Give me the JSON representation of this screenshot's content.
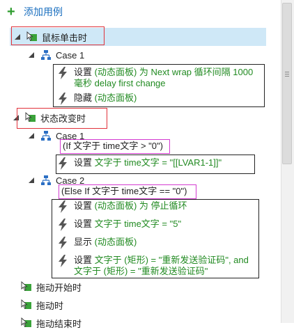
{
  "add_case": {
    "label": "添加用例"
  },
  "events": [
    {
      "label": "鼠标单击时"
    },
    {
      "label": "状态改变时"
    },
    {
      "label": "拖动开始时"
    },
    {
      "label": "拖动时"
    },
    {
      "label": "拖动结束时"
    }
  ],
  "click_case": {
    "name": "Case 1",
    "actions": [
      {
        "verb": "设置",
        "detail_line1": "(动态面板) 为 Next wrap 循环间隔 1000",
        "detail_line2": "毫秒 delay first change"
      },
      {
        "verb": "隐藏",
        "detail": "(动态面板)"
      }
    ]
  },
  "state_case1": {
    "name": "Case 1",
    "condition": "(If 文字于 time文字 > \"0\")",
    "actions": [
      {
        "verb": "设置",
        "detail": "文字于 time文字 = \"[[LVAR1-1]]\""
      }
    ]
  },
  "state_case2": {
    "name": "Case 2",
    "condition": "(Else If 文字于 time文字 == \"0\")",
    "actions": [
      {
        "verb": "设置",
        "detail": "(动态面板) 为 停止循环"
      },
      {
        "verb": "设置",
        "detail": "文字于 time文字 = \"5\""
      },
      {
        "verb": "显示",
        "detail": "(动态面板)"
      },
      {
        "verb": "设置",
        "detail_line1": "文字于 (矩形) = \"重新发送验证码\", and",
        "detail_line2": "文字于 (矩形) = \"重新发送验证码\""
      }
    ]
  }
}
